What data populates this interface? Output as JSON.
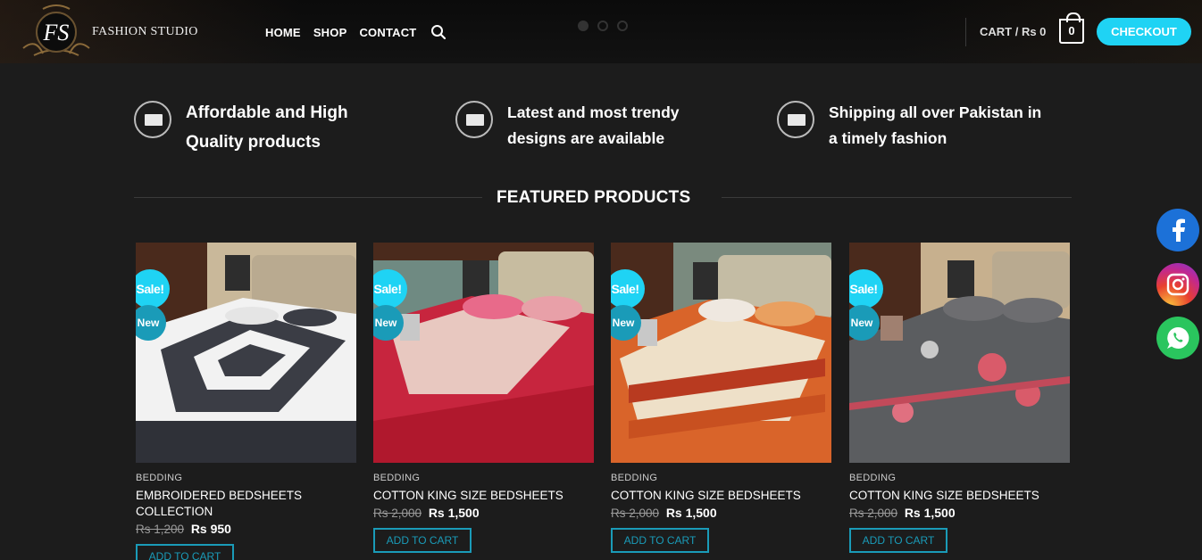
{
  "header": {
    "logo_text": "FS",
    "brand": "FASHION STUDIO",
    "nav": [
      "HOME",
      "SHOP",
      "CONTACT"
    ],
    "cart_label": "CART / Rs 0",
    "cart_count": "0",
    "checkout_label": "CHECKOUT",
    "slider_dots": 3,
    "accent_color": "#1fd3f4"
  },
  "features": [
    {
      "line1": "Affordable and High",
      "line2": "Quality products",
      "icon": "laptop-icon"
    },
    {
      "line1": "Latest and most trendy",
      "line2": "designs are available",
      "icon": "laptop-icon"
    },
    {
      "line1": "Shipping all over Pakistan in",
      "line2": "a timely fashion",
      "icon": "laptop-icon"
    }
  ],
  "section_title": "FEATURED PRODUCTS",
  "products": [
    {
      "badge_sale": "Sale!",
      "badge_new": "New",
      "category": "BEDDING",
      "name_line1": "EMBROIDERED BEDSHEETS",
      "name_line2": "COLLECTION",
      "old_price": "Rs 1,200",
      "price": "Rs 950",
      "button": "ADD TO CART"
    },
    {
      "badge_sale": "Sale!",
      "badge_new": "New",
      "category": "BEDDING",
      "name_line1": "COTTON KING SIZE BEDSHEETS",
      "name_line2": "",
      "old_price": "Rs 2,000",
      "price": "Rs 1,500",
      "button": "ADD TO CART"
    },
    {
      "badge_sale": "Sale!",
      "badge_new": "New",
      "category": "BEDDING",
      "name_line1": "COTTON KING SIZE BEDSHEETS",
      "name_line2": "",
      "old_price": "Rs 2,000",
      "price": "Rs 1,500",
      "button": "ADD TO CART"
    },
    {
      "badge_sale": "Sale!",
      "badge_new": "New",
      "category": "BEDDING",
      "name_line1": "COTTON KING SIZE BEDSHEETS",
      "name_line2": "",
      "old_price": "Rs 2,000",
      "price": "Rs 1,500",
      "button": "ADD TO CART"
    }
  ],
  "social": [
    "facebook-icon",
    "instagram-icon",
    "whatsapp-icon"
  ]
}
